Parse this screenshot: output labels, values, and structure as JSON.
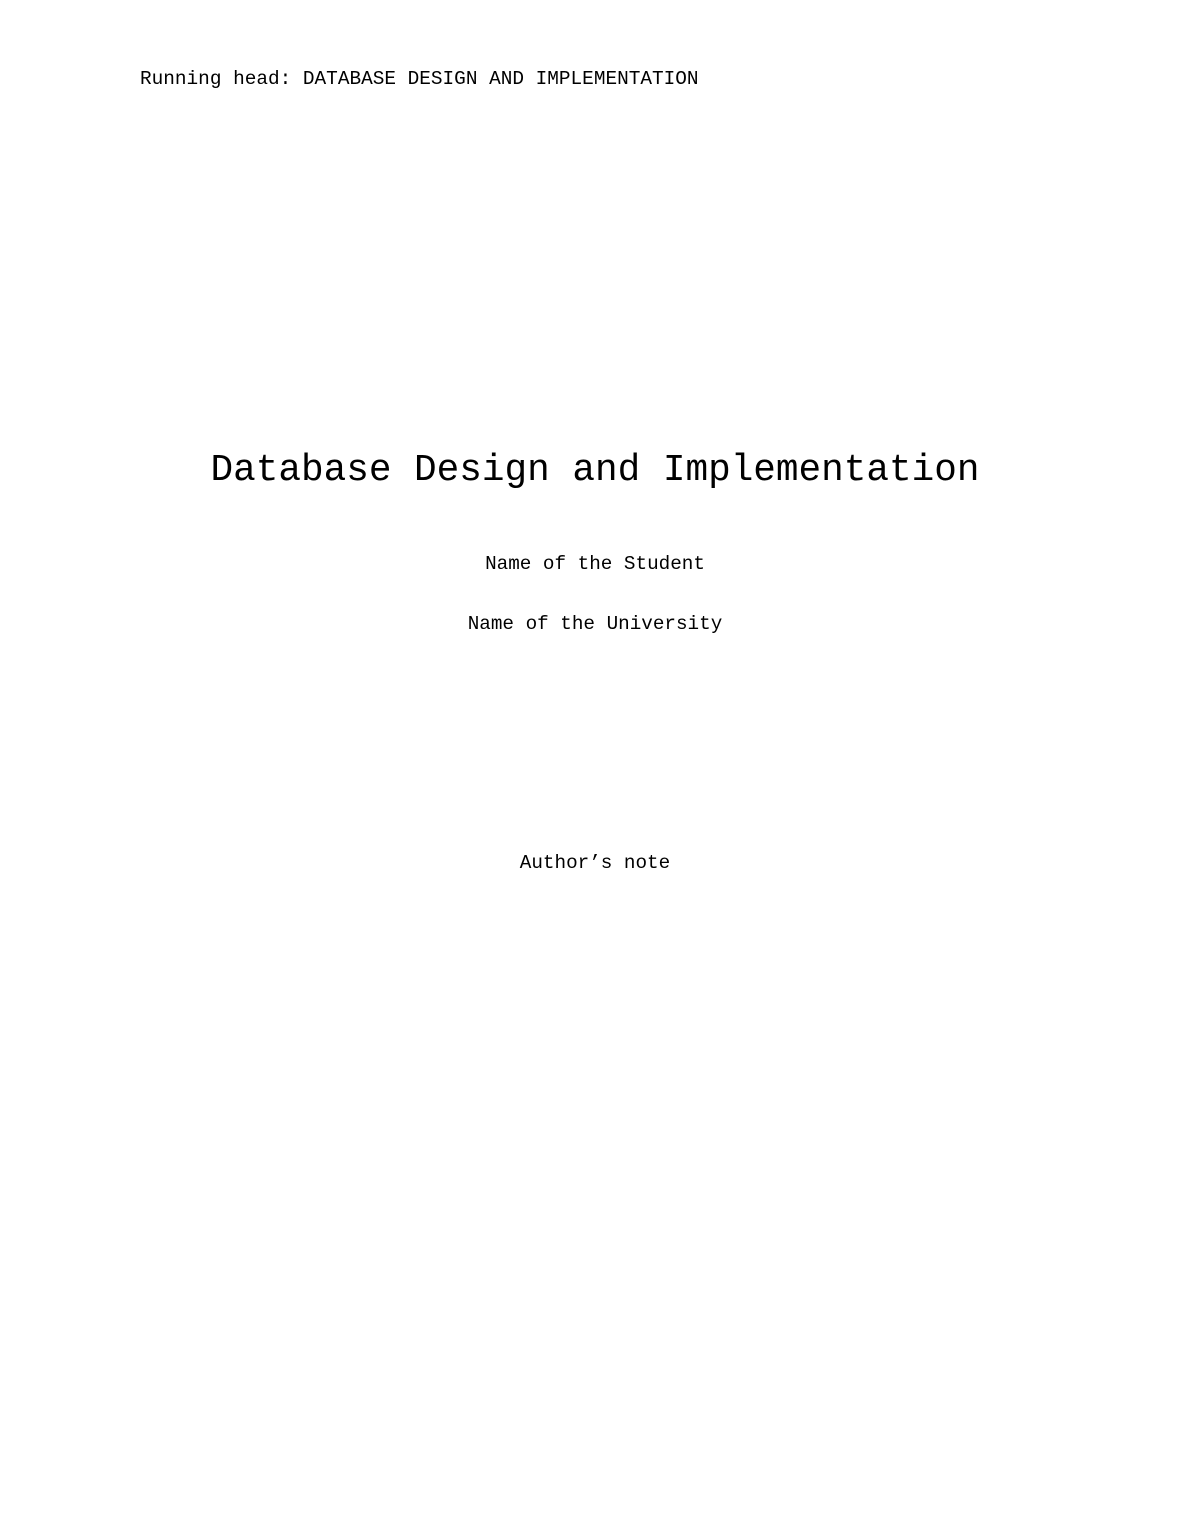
{
  "header": {
    "running_head": "Running head: DATABASE DESIGN AND IMPLEMENTATION"
  },
  "title_page": {
    "title": "Database Design and Implementation",
    "student_name": "Name of the Student",
    "university_name": "Name of the University",
    "author_note": "Author’s note"
  }
}
